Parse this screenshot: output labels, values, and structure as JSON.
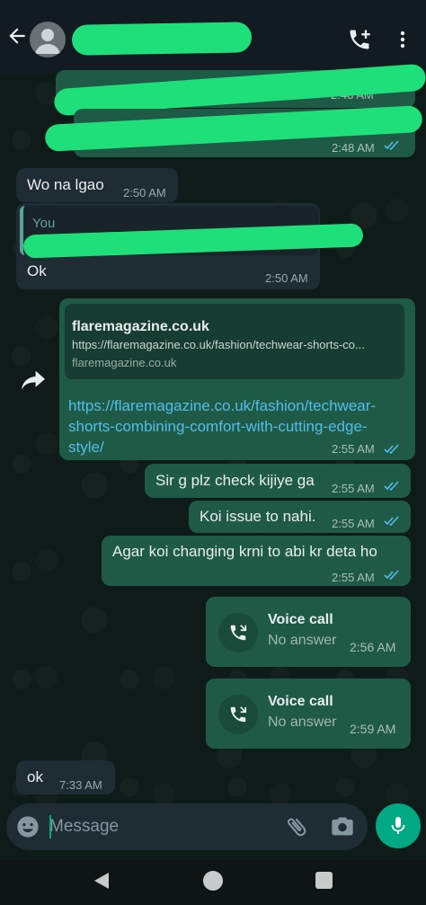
{
  "header": {
    "contact_name": "",
    "icons": [
      "back-arrow-icon",
      "avatar-icon",
      "add-call-icon",
      "more-vert-icon"
    ]
  },
  "messages": {
    "m1_text": "",
    "m1_time": "2:48 AM",
    "m2_time": "2:48 AM",
    "m3_text": "Wo na lgao",
    "m3_time": "2:50 AM",
    "m4_reply_author": "You",
    "m4_text": "Ok",
    "m4_time": "2:50 AM",
    "link_preview": {
      "title": "flaremagazine.co.uk",
      "url": "https://flaremagazine.co.uk/fashion/techwear-shorts-co...",
      "domain": "flaremagazine.co.uk"
    },
    "m5_link": "https://flaremagazine.co.uk/fashion/techwear-shorts-combining-comfort-with-cutting-edge-style/",
    "m5_time": "2:55 AM",
    "m6_text": "Sir g plz check kijiye ga",
    "m6_time": "2:55 AM",
    "m7_text": "Koi issue to nahi.",
    "m7_time": "2:55 AM",
    "m8_text": "Agar koi changing krni to abi kr deta ho",
    "m8_time": "2:55 AM",
    "call1": {
      "title": "Voice call",
      "status": "No answer",
      "time": "2:56 AM"
    },
    "call2": {
      "title": "Voice call",
      "status": "No answer",
      "time": "2:59 AM"
    },
    "m9_text": "ok",
    "m9_time": "7:33 AM"
  },
  "input": {
    "placeholder": "Message",
    "value": ""
  },
  "colors": {
    "accent": "#00a884",
    "outgoing_bubble": "#1f5a46",
    "incoming_bubble": "#202c33",
    "read_ticks": "#53bdeb"
  }
}
